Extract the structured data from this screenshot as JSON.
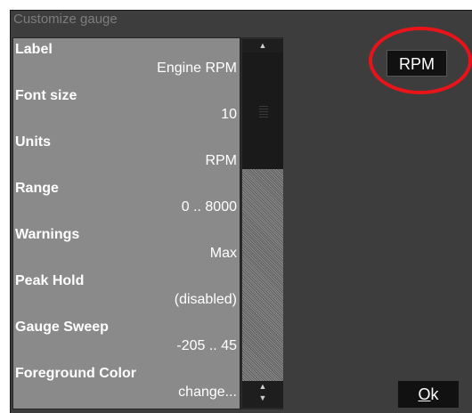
{
  "dialog": {
    "title": "Customize gauge",
    "settings": [
      {
        "label": "Label",
        "value": "Engine RPM"
      },
      {
        "label": "Font size",
        "value": "10"
      },
      {
        "label": "Units",
        "value": "RPM"
      },
      {
        "label": "Range",
        "value": "0 .. 8000"
      },
      {
        "label": "Warnings",
        "value": "Max"
      },
      {
        "label": "Peak Hold",
        "value": "(disabled)"
      },
      {
        "label": "Gauge Sweep",
        "value": "-205 .. 45"
      },
      {
        "label": "Foreground Color",
        "value": "change..."
      }
    ],
    "scroll_up": "▲",
    "scroll_down_a": "▲",
    "scroll_down_b": "▼",
    "preview_button": "RPM",
    "ok_first": "O",
    "ok_rest": "k"
  },
  "colors": {
    "dialog_bg": "#3d3d3d",
    "list_bg": "#8a8a8a",
    "button_bg": "#111111",
    "highlight": "#e8141a"
  }
}
